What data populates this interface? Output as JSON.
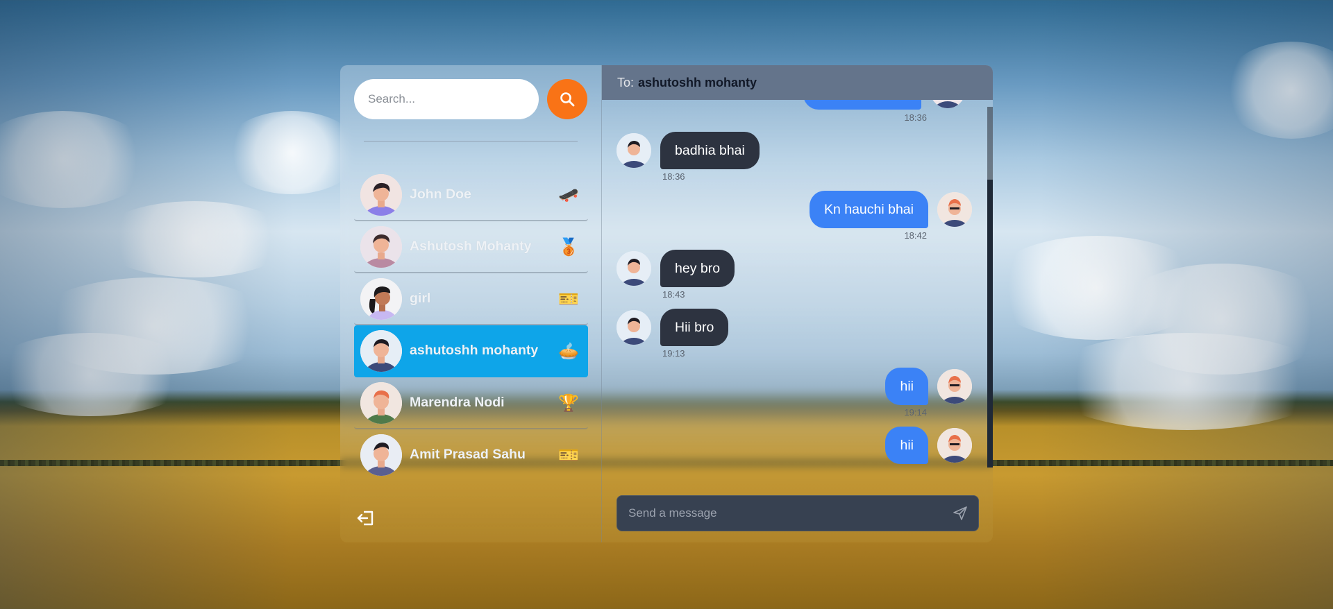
{
  "search": {
    "placeholder": "Search..."
  },
  "contacts": [
    {
      "name": "John Doe",
      "emoji": "🛹",
      "emoji_name": "skateboard-icon"
    },
    {
      "name": "Ashutosh Mohanty",
      "emoji": "🥉",
      "emoji_name": "bronze-medal-icon"
    },
    {
      "name": "girl",
      "emoji": "🎫",
      "emoji_name": "ticket-icon"
    },
    {
      "name": "ashutoshh mohanty",
      "emoji": "🥧",
      "emoji_name": "pie-icon",
      "active": true
    },
    {
      "name": "Marendra Nodi",
      "emoji": "🏆",
      "emoji_name": "trophy-icon"
    },
    {
      "name": "Amit Prasad Sahu",
      "emoji": "🎫",
      "emoji_name": "ticket-icon"
    }
  ],
  "chat": {
    "to_label": "To:",
    "to_name": "ashutoshh mohanty",
    "messages": [
      {
        "text": "",
        "time": "18:36",
        "direction": "out"
      },
      {
        "text": "badhia bhai",
        "time": "18:36",
        "direction": "in"
      },
      {
        "text": "Kn hauchi bhai",
        "time": "18:42",
        "direction": "out"
      },
      {
        "text": "hey bro",
        "time": "18:43",
        "direction": "in"
      },
      {
        "text": "Hii bro",
        "time": "19:13",
        "direction": "in"
      },
      {
        "text": "hii",
        "time": "19:14",
        "direction": "out"
      },
      {
        "text": "hii",
        "time": "",
        "direction": "out"
      }
    ],
    "composer_placeholder": "Send a message"
  },
  "colors": {
    "accent_orange": "#f97316",
    "active_contact": "#0ea5e9",
    "outgoing_bubble": "#3b82f6",
    "incoming_bubble": "#2d3340",
    "header": "#64748b"
  }
}
